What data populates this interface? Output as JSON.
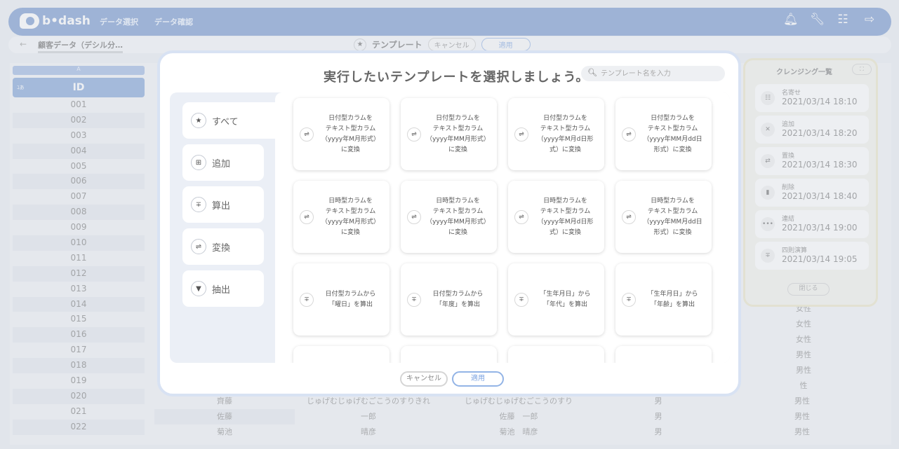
{
  "header": {
    "logo": "b•dash",
    "nav": [
      "データ選択",
      "データ確認"
    ],
    "icons": [
      "bell-icon",
      "wrench-icon",
      "grid-icon",
      "logout-icon"
    ]
  },
  "subheader": {
    "back": "←",
    "breadcrumb": "顧客データ（デシル分…",
    "template_label": "テンプレート",
    "cancel": "キャンセル",
    "apply": "適用"
  },
  "table": {
    "col_letter": "A",
    "col_type": "ｺあ",
    "col_name": "ID",
    "ids": [
      "001",
      "002",
      "003",
      "004",
      "005",
      "006",
      "007",
      "008",
      "009",
      "010",
      "011",
      "012",
      "013",
      "014",
      "015",
      "016",
      "017",
      "018",
      "019",
      "020",
      "021",
      "022"
    ],
    "bottom_rows": [
      {
        "surname": "齊藤",
        "long": "じゅげむじゅげむごこうのすりきれ",
        "long2": "じゅげむじゅげむごこうのすり",
        "sex": "男",
        "sex2": "男性"
      },
      {
        "surname": "佐藤",
        "long": "一郎",
        "long2": "佐藤　一郎",
        "sex": "男",
        "sex2": "男性"
      },
      {
        "surname": "菊池",
        "long": "晴彦",
        "long2": "菊池　晴彦",
        "sex": "男",
        "sex2": "男性"
      }
    ],
    "gender_col": [
      "女性",
      "女性",
      "女性",
      "男性",
      "男性",
      "性"
    ]
  },
  "cleansing_panel": {
    "title": "クレンジング一覧",
    "expand": "⛶",
    "items": [
      {
        "name": "名寄せ",
        "time": "2021/03/14 18:10",
        "icon": "merge-icon",
        "glyph": "☷"
      },
      {
        "name": "追加",
        "time": "2021/03/14 18:20",
        "icon": "add-icon",
        "glyph": "✕"
      },
      {
        "name": "置換",
        "time": "2021/03/14 18:30",
        "icon": "replace-icon",
        "glyph": "⇄"
      },
      {
        "name": "削除",
        "time": "2021/03/14 18:40",
        "icon": "trash-icon",
        "glyph": "▮"
      },
      {
        "name": "連結",
        "time": "2021/03/14 19:00",
        "icon": "concat-icon",
        "glyph": "•••"
      },
      {
        "name": "四則演算",
        "time": "2021/03/14 19:05",
        "icon": "calc-icon",
        "glyph": "∓"
      }
    ],
    "close": "閉じる"
  },
  "modal": {
    "title": "実行したいテンプレートを選択しましょう。",
    "search_placeholder": "テンプレート名を入力",
    "categories": [
      {
        "label": "すべて",
        "icon": "star-icon",
        "glyph": "★"
      },
      {
        "label": "追加",
        "icon": "plus-box-icon",
        "glyph": "⊞"
      },
      {
        "label": "算出",
        "icon": "calc-icon",
        "glyph": "∓"
      },
      {
        "label": "変換",
        "icon": "convert-icon",
        "glyph": "⇌"
      },
      {
        "label": "抽出",
        "icon": "filter-icon",
        "glyph": "▼"
      }
    ],
    "cards": [
      {
        "text": "日付型カラムを\nテキスト型カラム\n（yyyy年M月形式）\nに変換",
        "icon": "convert-icon",
        "glyph": "⇌"
      },
      {
        "text": "日付型カラムを\nテキスト型カラム\n（yyyy年MM月形式）\nに変換",
        "icon": "convert-icon",
        "glyph": "⇌"
      },
      {
        "text": "日付型カラムを\nテキスト型カラム\n（yyyy年M月d日形\n式）に変換",
        "icon": "convert-icon",
        "glyph": "⇌"
      },
      {
        "text": "日付型カラムを\nテキスト型カラム\n（yyyy年MM月dd日\n形式）に変換",
        "icon": "convert-icon",
        "glyph": "⇌"
      },
      {
        "text": "日時型カラムを\nテキスト型カラム\n（yyyy年M月形式）\nに変換",
        "icon": "convert-icon",
        "glyph": "⇌"
      },
      {
        "text": "日時型カラムを\nテキスト型カラム\n（yyyy年MM月形式）\nに変換",
        "icon": "convert-icon",
        "glyph": "⇌"
      },
      {
        "text": "日時型カラムを\nテキスト型カラム\n（yyyy年M月d日形\n式）に変換",
        "icon": "convert-icon",
        "glyph": "⇌"
      },
      {
        "text": "日時型カラムを\nテキスト型カラム\n（yyyy年MM月dd日\n形式）に変換",
        "icon": "convert-icon",
        "glyph": "⇌"
      },
      {
        "text": "日付型カラムから\n「曜日」を算出",
        "icon": "calc-icon",
        "glyph": "∓"
      },
      {
        "text": "日付型カラムから\n「年度」を算出",
        "icon": "calc-icon",
        "glyph": "∓"
      },
      {
        "text": "「生年月日」から\n「年代」を算出",
        "icon": "calc-icon",
        "glyph": "∓"
      },
      {
        "text": "「生年月日」から\n「年齢」を算出",
        "icon": "calc-icon",
        "glyph": "∓"
      }
    ],
    "cancel": "キャンセル",
    "apply": "適用"
  }
}
